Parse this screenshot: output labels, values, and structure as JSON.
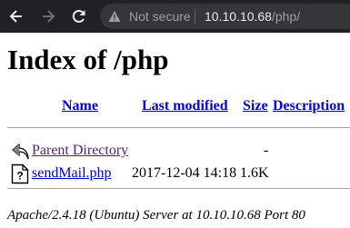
{
  "browser": {
    "security_label": "Not secure",
    "url_host": "10.10.10.68",
    "url_path": "/php/"
  },
  "page": {
    "title": "Index of /php",
    "columns": {
      "name": "Name",
      "last_modified": "Last modified",
      "size": "Size",
      "description": "Description"
    },
    "rows": [
      {
        "icon": "back-arrow-icon",
        "name": "Parent Directory",
        "modified": "",
        "size": "-",
        "description": ""
      },
      {
        "icon": "unknown-file-icon",
        "name": "sendMail.php",
        "modified": "2017-12-04 14:18",
        "size": "1.6K",
        "description": ""
      }
    ],
    "server_signature": "Apache/2.4.18 (Ubuntu) Server at 10.10.10.68 Port 80"
  }
}
